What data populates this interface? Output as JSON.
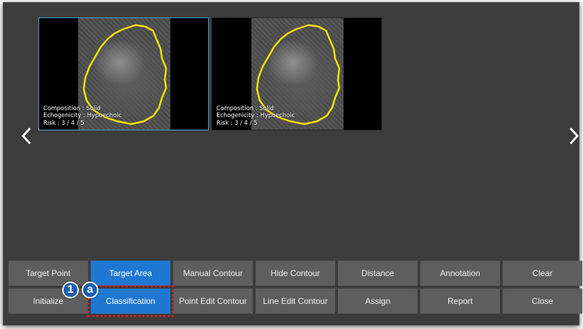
{
  "thumbnails": [
    {
      "composition": "Composition : Solid",
      "echogenicity": "Echogenicity : Hypoechoic",
      "risk": "Risk : 3 / 4 / 5",
      "selected": true
    },
    {
      "composition": "Composition : Solid",
      "echogenicity": "Echogenicity : Hypoechoic",
      "risk": "Risk : 3 / 4 / 5",
      "selected": false
    }
  ],
  "nav": {
    "prev_icon": "chevron-left-icon",
    "next_icon": "chevron-right-icon"
  },
  "toolbar": {
    "row1": [
      "Target Point",
      "Target Area",
      "Manual Contour",
      "Hide Contour",
      "Distance",
      "Annotation",
      "Clear"
    ],
    "row2": [
      "Initialize",
      "Classification",
      "Point Edit Contour",
      "Line Edit Contour",
      "Assign",
      "Report",
      "Close"
    ],
    "active": [
      "Target Area",
      "Classification"
    ],
    "highlighted": "Classification"
  },
  "callouts": {
    "step": "1",
    "sub": "a"
  },
  "colors": {
    "background": "#3c3c3c",
    "button": "#5e5e5e",
    "button_active": "#1e78d2",
    "contour": "#ffe400",
    "highlight_border": "#d81e1e",
    "badge": "#1e5fb0"
  }
}
